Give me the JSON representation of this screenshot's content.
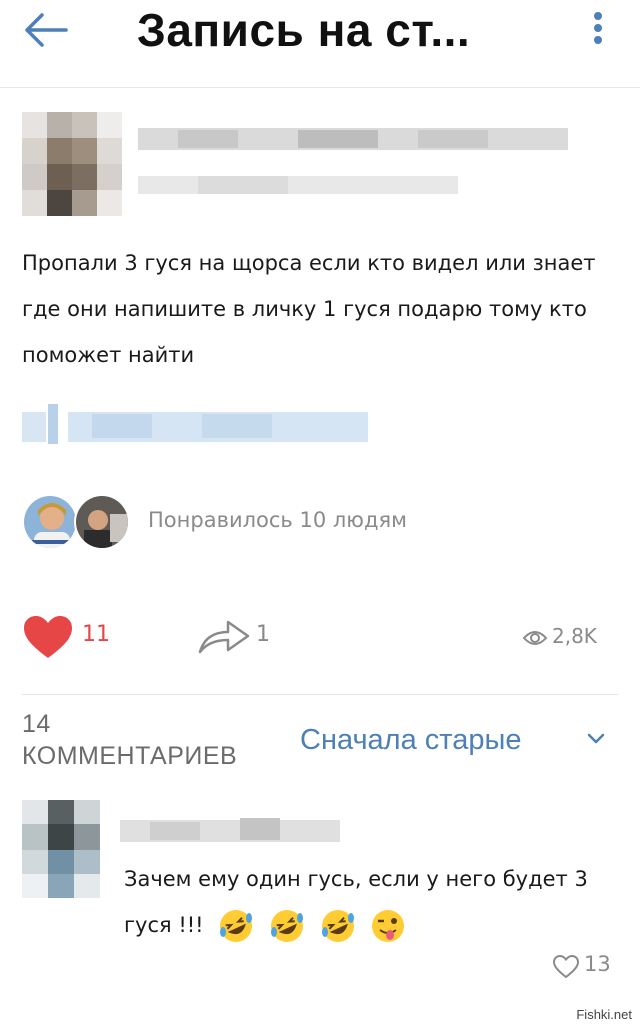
{
  "header": {
    "title": "Запись на ст...",
    "back_icon": "arrow-left-icon",
    "menu_icon": "more-vertical-icon",
    "accent_color": "#4c80b7"
  },
  "post": {
    "text": "Пропали 3 гуся на щорса если кто видел или знает где они напишите в личку 1 гуся подарю тому кто поможет найти",
    "liked_by": "Понравилось 10 людям",
    "likes": "11",
    "shares": "1",
    "views": "2,8K",
    "like_color": "#e64646"
  },
  "comments": {
    "count_number": "14",
    "count_label": "КОММЕНТАРИЕВ",
    "sort_label": "Сначала старые",
    "items": [
      {
        "text": "Зачем ему один гусь, если у него будет 3 гуся !!!",
        "emojis": [
          "rolling-laughing-emoji",
          "rolling-laughing-emoji",
          "rolling-laughing-emoji",
          "winking-tongue-emoji"
        ],
        "likes": "13"
      }
    ]
  },
  "watermark": "Fishki.net"
}
